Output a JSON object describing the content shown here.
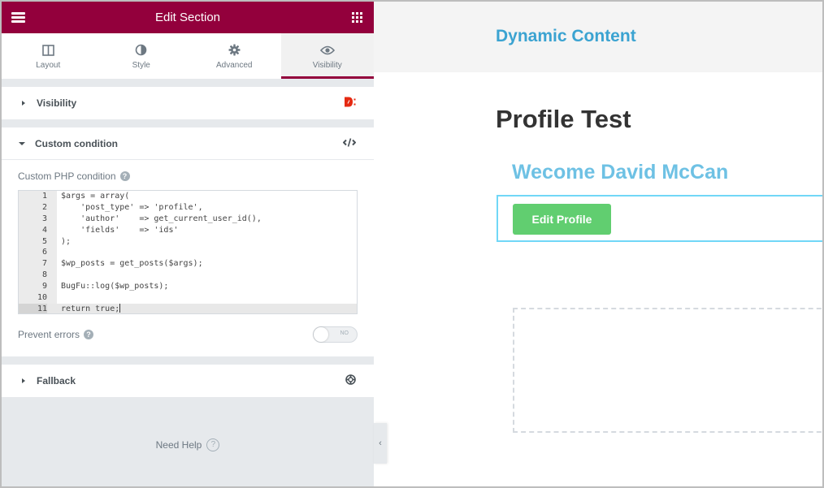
{
  "panel": {
    "header_title": "Edit Section",
    "tabs": [
      {
        "label": "Layout",
        "icon": "columns-icon"
      },
      {
        "label": "Style",
        "icon": "half-circle-icon"
      },
      {
        "label": "Advanced",
        "icon": "gear-icon"
      },
      {
        "label": "Visibility",
        "icon": "eye-icon",
        "active": true
      }
    ],
    "sections": {
      "visibility": {
        "label": "Visibility",
        "icon": "dynamic-logo-icon",
        "expanded": false
      },
      "custom_condition": {
        "label": "Custom condition",
        "icon": "code-icon",
        "expanded": true
      },
      "fallback": {
        "label": "Fallback",
        "icon": "lifebuoy-icon",
        "expanded": false
      }
    },
    "custom_php_label": "Custom PHP condition",
    "help_glyph": "?",
    "code_lines": [
      {
        "n": "1",
        "text": "$args = array("
      },
      {
        "n": "2",
        "text": "    'post_type' => 'profile',"
      },
      {
        "n": "3",
        "text": "    'author'    => get_current_user_id(),"
      },
      {
        "n": "4",
        "text": "    'fields'    => 'ids'"
      },
      {
        "n": "5",
        "text": ");"
      },
      {
        "n": "6",
        "text": ""
      },
      {
        "n": "7",
        "text": "$wp_posts = get_posts($args);"
      },
      {
        "n": "8",
        "text": ""
      },
      {
        "n": "9",
        "text": "BugFu::log($wp_posts);"
      },
      {
        "n": "10",
        "text": ""
      },
      {
        "n": "11",
        "text": "return true;"
      }
    ],
    "active_line": 11,
    "prevent_errors_label": "Prevent errors",
    "prevent_errors_toggle": "NO",
    "need_help_label": "Need Help",
    "collapse_glyph": "‹"
  },
  "preview": {
    "site_title": "Dynamic Content",
    "page_title": "Profile Test",
    "welcome_heading": "Wecome David McCan",
    "edit_profile_button": "Edit Profile"
  },
  "colors": {
    "brand": "#93003c",
    "site_title": "#3ba3d1",
    "welcome": "#6ec1e4",
    "button": "#61ce70",
    "selection": "#71d7f7"
  }
}
